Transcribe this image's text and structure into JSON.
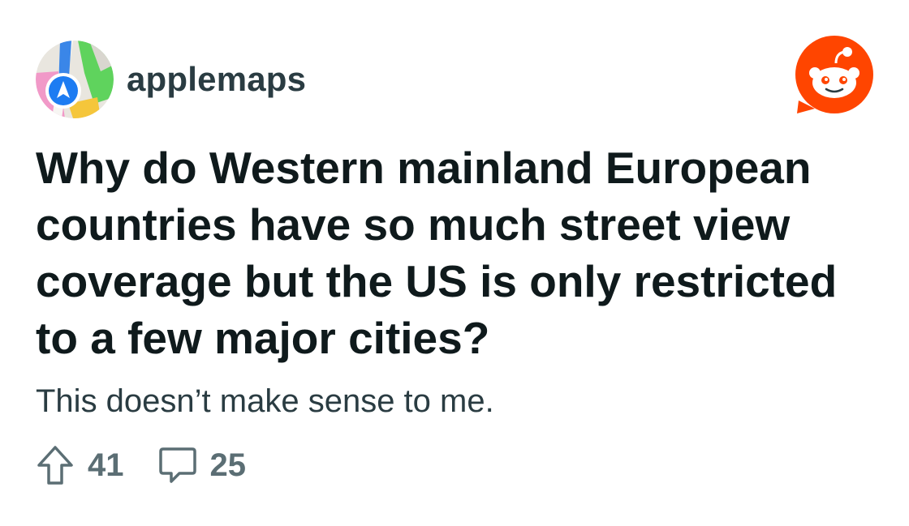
{
  "post": {
    "community": "applemaps",
    "title": "Why do Western mainland European countries have so much street view coverage but the US is only restricted to a few major cities?",
    "body": "This doesn’t make sense to me.",
    "upvotes": "41",
    "comments": "25"
  },
  "icons": {
    "avatar": "apple-maps-icon",
    "brand": "reddit-logo-icon",
    "upvote": "upvote-arrow-icon",
    "comment": "comment-bubble-icon"
  },
  "colors": {
    "reddit_orange": "#ff4500",
    "title_text": "#0f1a1c",
    "body_text": "#2a3c42",
    "meta_text": "#5b6e74",
    "background": "#ffffff"
  }
}
